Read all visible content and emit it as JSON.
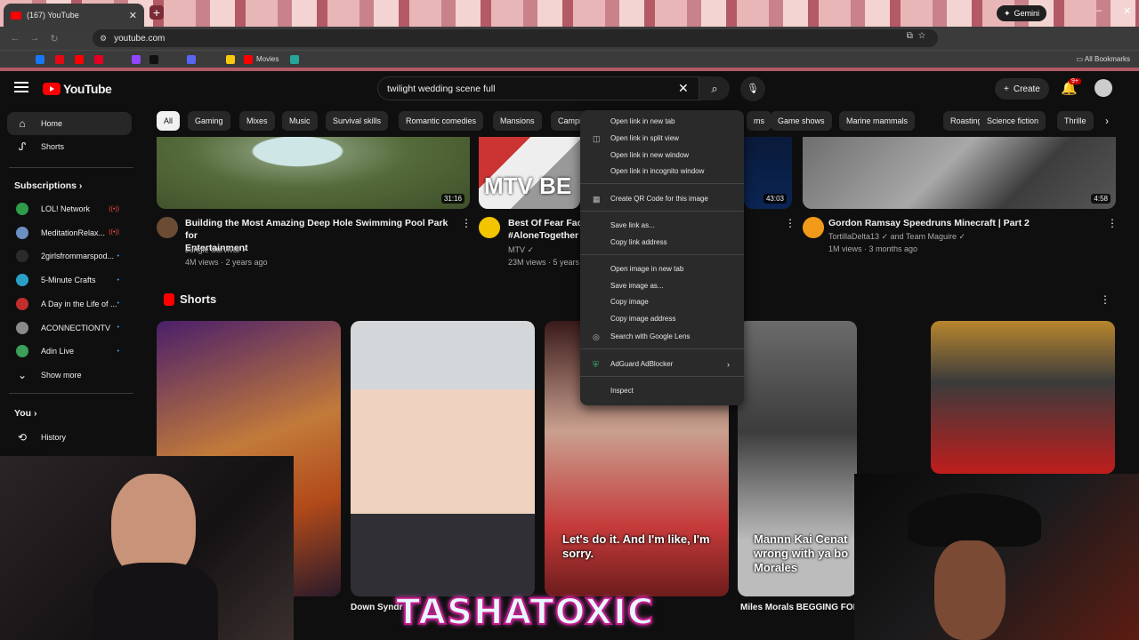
{
  "browser": {
    "tab_title": "(167) YouTube",
    "url": "youtube.com",
    "gemini_label": "Gemini",
    "bookmarks_movies": "Movies",
    "all_bookmarks": "All Bookmarks"
  },
  "header": {
    "logo_text": "YouTube",
    "search_value": "twilight wedding scene full",
    "create_label": "Create",
    "notif_count": "9+"
  },
  "sidebar": {
    "home": "Home",
    "shorts": "Shorts",
    "subscriptions": "Subscriptions",
    "channels": [
      {
        "name": "LOL! Network",
        "color": "#2e9c4a",
        "live": true
      },
      {
        "name": "MeditationRelax...",
        "color": "#6b8fc2",
        "live": true
      },
      {
        "name": "2girlsfrommarspod...",
        "color": "#2b2b2b",
        "live": false
      },
      {
        "name": "5-Minute Crafts",
        "color": "#2aa0c8",
        "live": false
      },
      {
        "name": "A Day in the Life of ...",
        "color": "#c22d2d",
        "live": false
      },
      {
        "name": "ACONNECTIONTV",
        "color": "#8a8a8a",
        "live": false
      },
      {
        "name": "Adin Live",
        "color": "#3aa05a",
        "live": false
      }
    ],
    "show_more": "Show more",
    "you": "You",
    "history": "History"
  },
  "chips": [
    "All",
    "Gaming",
    "Mixes",
    "Music",
    "Survival skills",
    "Romantic comedies",
    "Mansions",
    "Campi",
    "ms",
    "Game shows",
    "Marine mammals",
    "Roasting",
    "Science fiction",
    "Thrille"
  ],
  "videos": [
    {
      "title_line1": "Building the Most Amazing Deep Hole Swimming Pool Park for",
      "title_line2": "Entertainment",
      "channel": "Jungle Survival",
      "meta": "4M views · 2 years ago",
      "duration": "31:16"
    },
    {
      "title_line1": "Best Of Fear Fact",
      "title_line2": "#AloneTogether",
      "channel": "MTV",
      "meta": "23M views · 5 years",
      "duration": ""
    },
    {
      "title_line1": "",
      "title_line2": "",
      "channel": "",
      "meta": "",
      "duration": "43:03"
    },
    {
      "title_line1": "Gordon Ramsay Speedruns Minecraft | Part 2",
      "title_line2": "",
      "channel": "TortillaDelta13",
      "channel2": "and Team Maguire",
      "meta": "1M views · 3 months ago",
      "duration": "4:58"
    }
  ],
  "shorts": {
    "heading": "Shorts",
    "items": [
      {
        "title": "",
        "caption": ""
      },
      {
        "title": "Down Syndr",
        "caption": ""
      },
      {
        "title": "",
        "caption": "Let's do it. And I'm like, I'm sorry."
      },
      {
        "title": "Miles Morals BEGGING FOR",
        "caption": "Mannn Kai Cenat wrong with ya bo Morales"
      }
    ]
  },
  "context_menu": {
    "items": [
      "Open link in new tab",
      "Open link in split view",
      "Open link in new window",
      "Open link in incognito window",
      "Create QR Code for this image",
      "Save link as...",
      "Copy link address",
      "Open image in new tab",
      "Save image as...",
      "Copy image",
      "Copy image address",
      "Search with Google Lens",
      "AdGuard AdBlocker",
      "Inspect"
    ]
  },
  "overlay": {
    "watermark": "TASHATOXIC"
  },
  "colors": {
    "yt_red": "#ff0000",
    "bg": "#0f0f0f",
    "chip": "#272727",
    "menu": "#2a2a2a",
    "watermark_stroke": "#c2188a"
  }
}
